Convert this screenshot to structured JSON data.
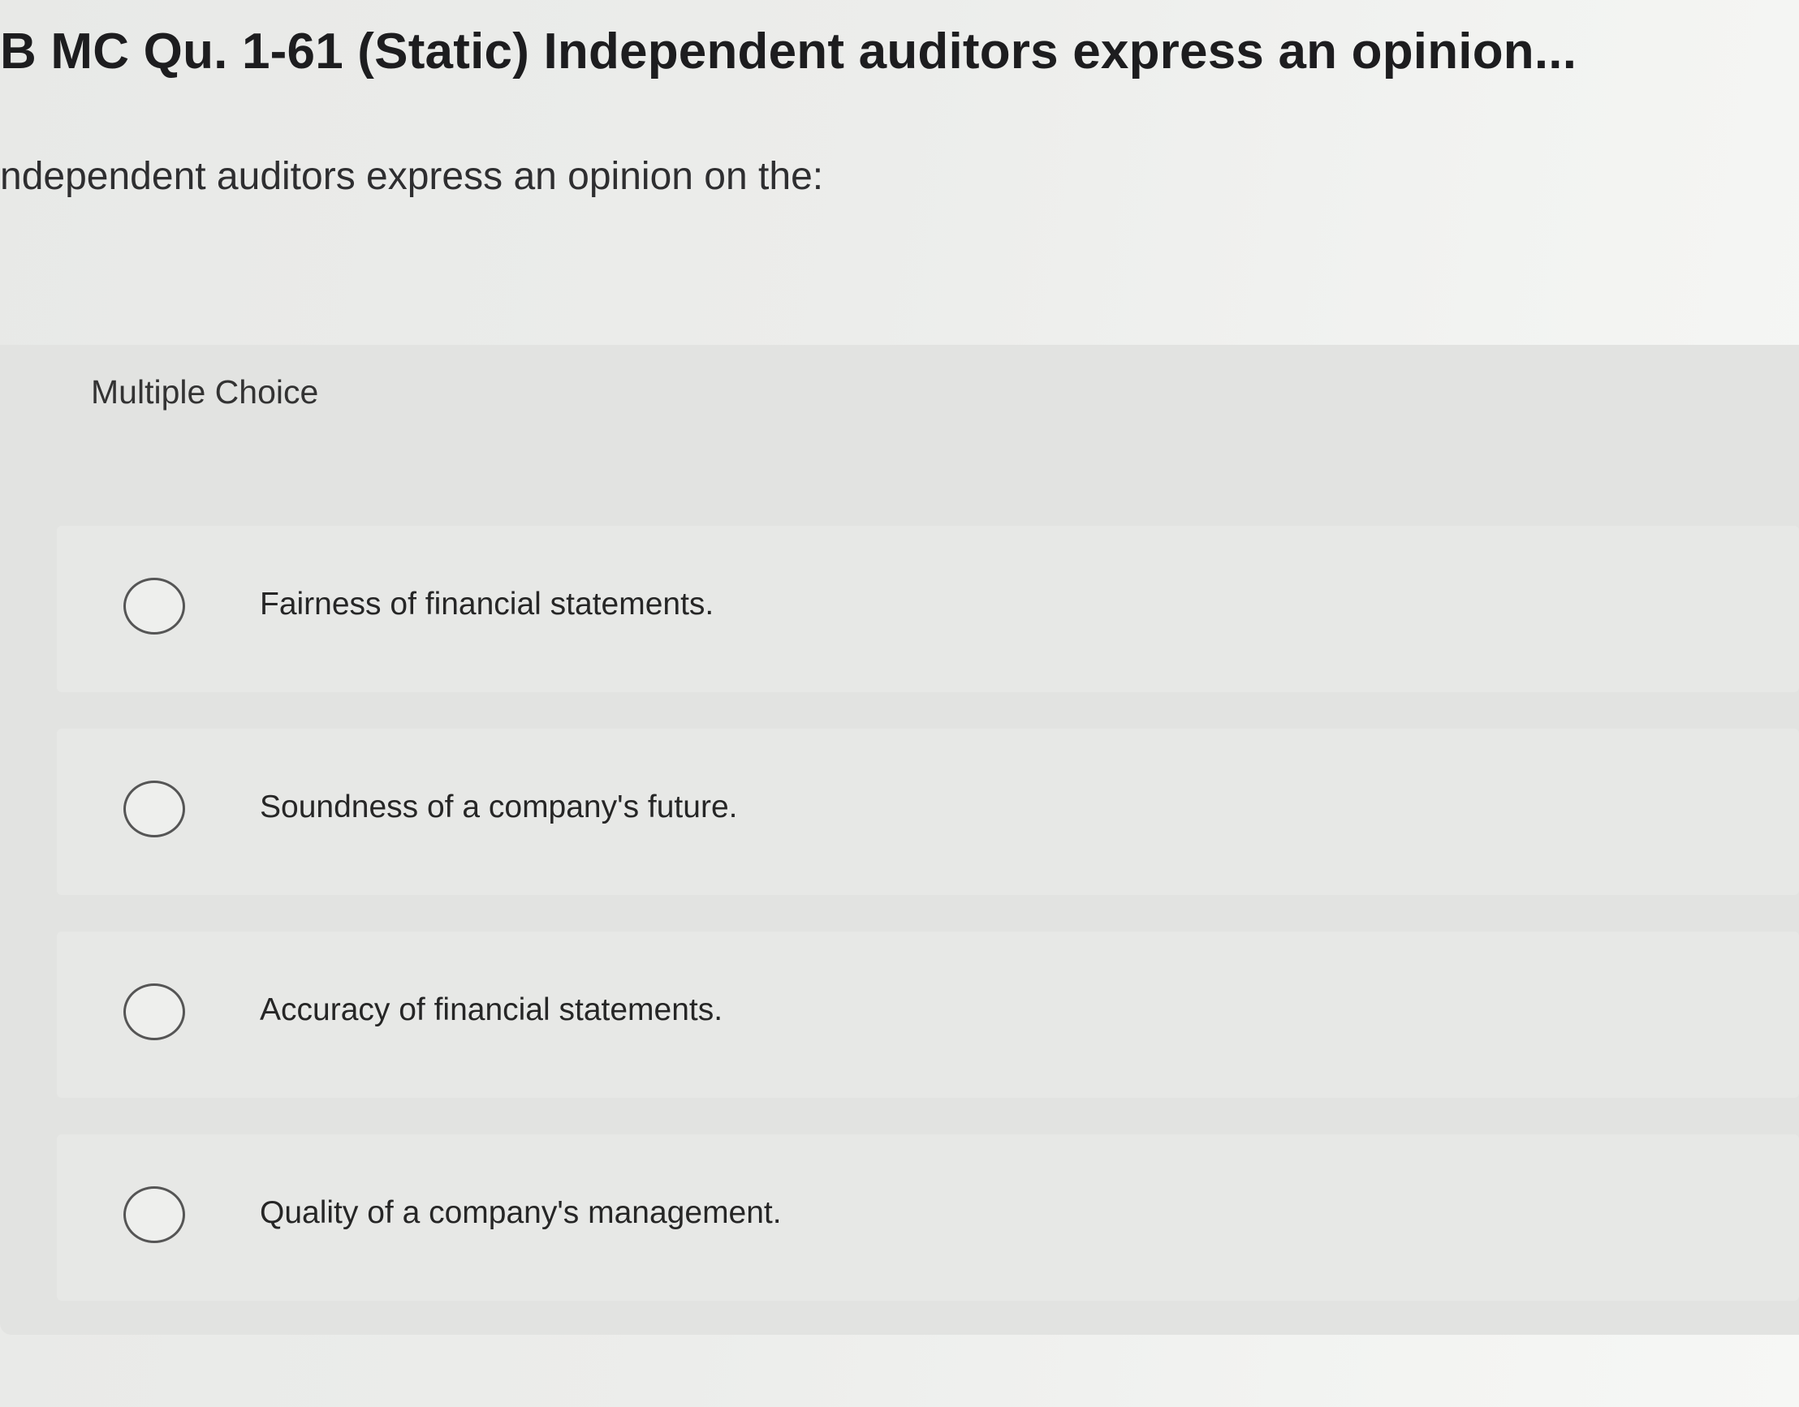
{
  "header": {
    "title": "B MC Qu. 1-61 (Static) Independent auditors express an opinion..."
  },
  "question": {
    "text": "ndependent auditors express an opinion on the:"
  },
  "multiple_choice": {
    "label": "Multiple Choice",
    "options": [
      {
        "label": "Fairness of financial statements.",
        "selected": false
      },
      {
        "label": "Soundness of a company's future.",
        "selected": false
      },
      {
        "label": "Accuracy of financial statements.",
        "selected": false
      },
      {
        "label": "Quality of a company's management.",
        "selected": false
      }
    ]
  },
  "colors": {
    "background": "#ecedeb",
    "panel": "#e2e3e1",
    "option_row": "#e7e8e6",
    "text": "#1d1d1f"
  }
}
